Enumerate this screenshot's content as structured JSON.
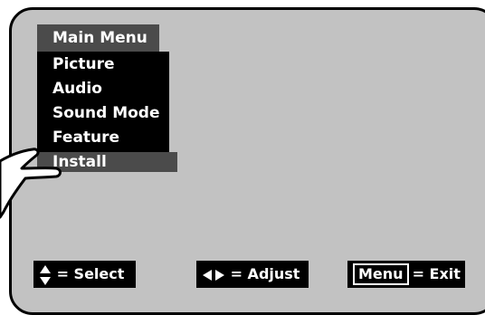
{
  "menu": {
    "title": "Main Menu",
    "items": [
      {
        "label": "Picture"
      },
      {
        "label": "Audio"
      },
      {
        "label": "Sound Mode"
      },
      {
        "label": "Feature"
      }
    ],
    "selected": {
      "label": "Install"
    }
  },
  "hints": {
    "select_label": "= Select",
    "adjust_label": "= Adjust",
    "exit_key": "Menu",
    "exit_label": "= Exit"
  },
  "icons": {
    "select": "up-down-arrows-icon",
    "adjust": "left-right-arrows-icon",
    "pointer": "pointing-hand-icon"
  },
  "colors": {
    "screen": "#c2c2c2",
    "highlight": "#4b4b4b",
    "menu_bg": "#000000",
    "text": "#ffffff"
  }
}
